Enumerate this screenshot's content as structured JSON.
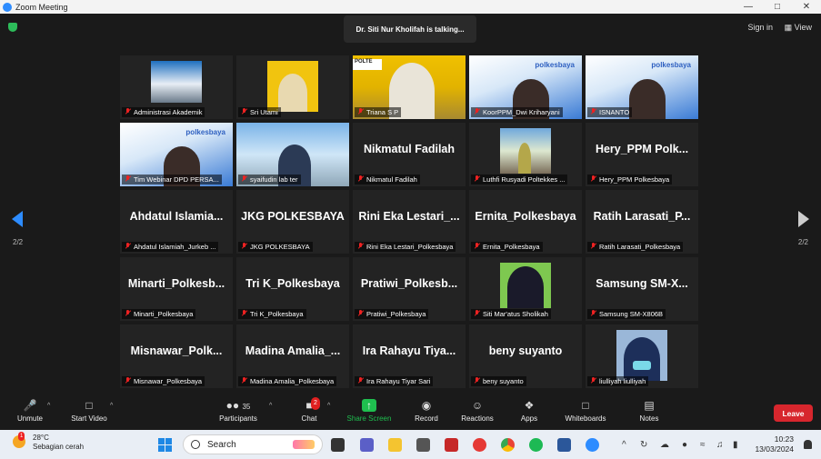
{
  "window": {
    "title": "Zoom Meeting",
    "controls": [
      "minimize-icon",
      "maximize-icon",
      "close-icon"
    ]
  },
  "meeting": {
    "talking_banner": "Dr. Siti Nur Kholifah is talking...",
    "sign_in": "Sign in",
    "view": "View",
    "page_left": "2/2",
    "page_right": "2/2"
  },
  "tiles": [
    {
      "name": "Administrasi Akademik",
      "big": "",
      "video": "office"
    },
    {
      "name": "Sri Utami",
      "big": "",
      "video": "yellow"
    },
    {
      "name": "Triana S P",
      "big": "",
      "video": "yellow"
    },
    {
      "name": "KoorPPM_Dwi Kriharyani",
      "big": "",
      "video": "banner"
    },
    {
      "name": "ISNANTO",
      "big": "",
      "video": "banner"
    },
    {
      "name": "Tim Webinar DPD PERSA...",
      "big": "",
      "video": "banner"
    },
    {
      "name": "syaifudin lab ter",
      "big": "",
      "video": "building"
    },
    {
      "name": "Nikmatul Fadilah",
      "big": "Nikmatul Fadilah",
      "video": "none"
    },
    {
      "name": "Luthfi Rusyadi Poltekkes ...",
      "big": "",
      "video": "photo"
    },
    {
      "name": "Hery_PPM Polkesbaya",
      "big": "Hery_PPM Polk...",
      "video": "none"
    },
    {
      "name": "Ahdatul Islamiah_Jurkeb ...",
      "big": "Ahdatul Islamia...",
      "video": "none"
    },
    {
      "name": "JKG POLKESBAYA",
      "big": "JKG POLKESBAYA",
      "video": "none"
    },
    {
      "name": "Rini Eka Lestari_Polkesbaya",
      "big": "Rini Eka Lestari_...",
      "video": "none"
    },
    {
      "name": "Ernita_Polkesbaya",
      "big": "Ernita_Polkesbaya",
      "video": "none"
    },
    {
      "name": "Ratih Larasati_Polkesbaya",
      "big": "Ratih Larasati_P...",
      "video": "none"
    },
    {
      "name": "Minarti_Polkesbaya",
      "big": "Minarti_Polkesb...",
      "video": "none"
    },
    {
      "name": "Tri K_Polkesbaya",
      "big": "Tri K_Polkesbaya",
      "video": "none"
    },
    {
      "name": "Pratiwi_Polkesbaya",
      "big": "Pratiwi_Polkesb...",
      "video": "none"
    },
    {
      "name": "Siti Mar'atus Sholikah",
      "big": "",
      "video": "photo2"
    },
    {
      "name": "Samsung SM-X806B",
      "big": "Samsung SM-X...",
      "video": "none"
    },
    {
      "name": "Misnawar_Polkesbaya",
      "big": "Misnawar_Polk...",
      "video": "none"
    },
    {
      "name": "Madina Amalia_Polkesbaya",
      "big": "Madina Amalia_...",
      "video": "none"
    },
    {
      "name": "Ira Rahayu Tiyar Sari",
      "big": "Ira Rahayu Tiya...",
      "video": "none"
    },
    {
      "name": "beny suyanto",
      "big": "beny suyanto",
      "video": "none"
    },
    {
      "name": "liulliyah liulliyah",
      "big": "",
      "video": "photo3"
    }
  ],
  "toolbar": {
    "unmute": "Unmute",
    "start_video": "Start Video",
    "participants": "Participants",
    "participants_count": "35",
    "chat": "Chat",
    "chat_badge": "2",
    "share_screen": "Share Screen",
    "record": "Record",
    "reactions": "Reactions",
    "apps": "Apps",
    "whiteboards": "Whiteboards",
    "notes": "Notes",
    "leave": "Leave"
  },
  "taskbar": {
    "weather_temp": "28°C",
    "weather_desc": "Sebagian cerah",
    "weather_badge": "1",
    "search_placeholder": "Search",
    "time": "10:23",
    "date": "13/03/2024"
  },
  "colors": {
    "accent_blue": "#2d8cff",
    "share_green": "#1fbf4f",
    "leave_red": "#d7262d",
    "muted_red": "#e22222"
  }
}
